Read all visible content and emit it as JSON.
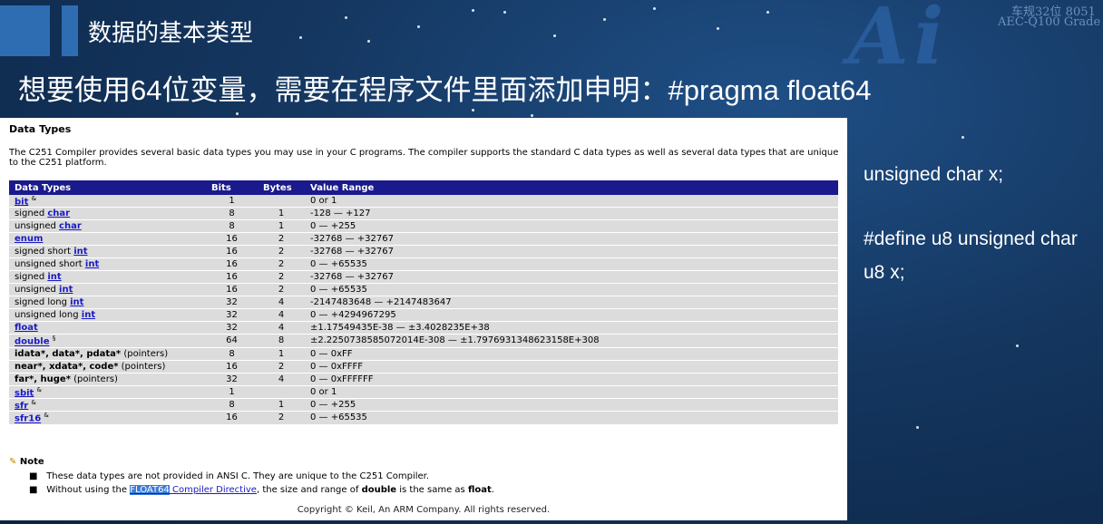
{
  "slide": {
    "section_title": "数据的基本类型",
    "headline": "想要使用64位变量，需要在程序文件里面添加申明：#pragma float64",
    "logo_text": "Ai",
    "logo_line1": "车规32位 8051",
    "logo_line2": "AEC-Q100 Grade"
  },
  "doc": {
    "title": "Data Types",
    "intro": "The C251 Compiler provides several basic data types you may use in your C programs. The compiler supports the standard C data types as well as several data types that are unique to the C251 platform.",
    "columns": [
      "Data Types",
      "Bits",
      "Bytes",
      "Value Range"
    ],
    "rows": [
      {
        "pre": "",
        "link": "bit",
        "post": "",
        "sup": "&",
        "bits": "1",
        "bytes": "",
        "range": "0 or 1"
      },
      {
        "pre": "signed ",
        "link": "char",
        "post": "",
        "sup": "",
        "bits": "8",
        "bytes": "1",
        "range": "-128 — +127"
      },
      {
        "pre": "unsigned ",
        "link": "char",
        "post": "",
        "sup": "",
        "bits": "8",
        "bytes": "1",
        "range": "0 — +255"
      },
      {
        "pre": "",
        "link": "enum",
        "post": "",
        "sup": "",
        "bits": "16",
        "bytes": "2",
        "range": "-32768 — +32767"
      },
      {
        "pre": "signed short ",
        "link": "int",
        "post": "",
        "sup": "",
        "bits": "16",
        "bytes": "2",
        "range": "-32768 — +32767"
      },
      {
        "pre": "unsigned short ",
        "link": "int",
        "post": "",
        "sup": "",
        "bits": "16",
        "bytes": "2",
        "range": "0 — +65535"
      },
      {
        "pre": "signed ",
        "link": "int",
        "post": "",
        "sup": "",
        "bits": "16",
        "bytes": "2",
        "range": "-32768 — +32767"
      },
      {
        "pre": "unsigned ",
        "link": "int",
        "post": "",
        "sup": "",
        "bits": "16",
        "bytes": "2",
        "range": "0 — +65535"
      },
      {
        "pre": "signed long ",
        "link": "int",
        "post": "",
        "sup": "",
        "bits": "32",
        "bytes": "4",
        "range": "-2147483648 — +2147483647"
      },
      {
        "pre": "unsigned long ",
        "link": "int",
        "post": "",
        "sup": "",
        "bits": "32",
        "bytes": "4",
        "range": "0 — +4294967295"
      },
      {
        "pre": "",
        "link": "float",
        "post": "",
        "sup": "",
        "bits": "32",
        "bytes": "4",
        "range": "±1.17549435E-38 — ±3.4028235E+38"
      },
      {
        "pre": "",
        "link": "double",
        "post": "",
        "sup": "§",
        "bits": "64",
        "bytes": "8",
        "range": "±2.2250738585072014E-308 — ±1.7976931348623158E+308"
      },
      {
        "pre": "",
        "link": "",
        "post": "",
        "bold": "idata*, data*, pdata*",
        "plain": " (pointers)",
        "sup": "",
        "bits": "8",
        "bytes": "1",
        "range": "0 — 0xFF"
      },
      {
        "pre": "",
        "link": "",
        "post": "",
        "bold": "near*, xdata*, code*",
        "plain": " (pointers)",
        "sup": "",
        "bits": "16",
        "bytes": "2",
        "range": "0 — 0xFFFF"
      },
      {
        "pre": "",
        "link": "",
        "post": "",
        "bold": "far*, huge*",
        "plain": " (pointers)",
        "sup": "",
        "bits": "32",
        "bytes": "4",
        "range": "0 — 0xFFFFFF"
      },
      {
        "pre": "",
        "link": "sbit",
        "post": "",
        "sup": "&",
        "bits": "1",
        "bytes": "",
        "range": "0 or 1"
      },
      {
        "pre": "",
        "link": "sfr",
        "post": "",
        "sup": "&",
        "bits": "8",
        "bytes": "1",
        "range": "0 — +255"
      },
      {
        "pre": "",
        "link": "sfr16",
        "post": "",
        "sup": "&",
        "bits": "16",
        "bytes": "2",
        "range": "0 — +65535"
      }
    ],
    "note_title": "Note",
    "note1": "These data types are not provided in ANSI C. They are unique to the C251 Compiler.",
    "note2_pre": "Without using the ",
    "note2_hl": "FLOAT64",
    "note2_link": " Compiler Directive",
    "note2_mid": ", the size and range of ",
    "note2_b1": "double",
    "note2_mid2": " is the same as ",
    "note2_b2": "float",
    "note2_end": ".",
    "copyright": "Copyright © Keil, An ARM Company. All rights reserved."
  },
  "side": {
    "line1": "unsigned char x;",
    "line2": "#define u8 unsigned char",
    "line3": "u8 x;"
  }
}
